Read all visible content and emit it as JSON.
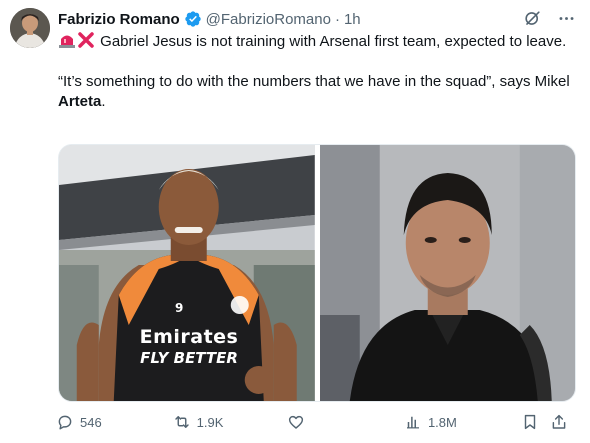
{
  "author": {
    "name": "Fabrizio Romano",
    "handle": "@FabrizioRomano",
    "separator": "·",
    "time": "1h"
  },
  "tweet": {
    "line1": "Gabriel Jesus is not training with Arsenal first team, expected to leave.",
    "quote_start": "“It’s something to do with the numbers that we have in the squad”, says Mikel ",
    "quote_bold": "Arteta",
    "quote_end": "."
  },
  "media": {
    "photo1_shirt_number": "9",
    "photo1_sponsor_line1": "Emirates",
    "photo1_sponsor_line2": "FLY BETTER"
  },
  "actions": {
    "replies": "546",
    "reposts": "1.9K",
    "views": "1.8M"
  },
  "colors": {
    "text_primary": "#0f1419",
    "text_secondary": "#536471",
    "verified_blue": "#1d9bf0",
    "jersey_orange": "#f08a3b"
  },
  "icons": [
    "verified-badge-icon",
    "grok-icon",
    "more-icon",
    "siren-emoji-icon",
    "cross-mark-emoji-icon",
    "reply-icon",
    "repost-icon",
    "like-icon",
    "views-icon",
    "bookmark-icon",
    "share-icon"
  ]
}
